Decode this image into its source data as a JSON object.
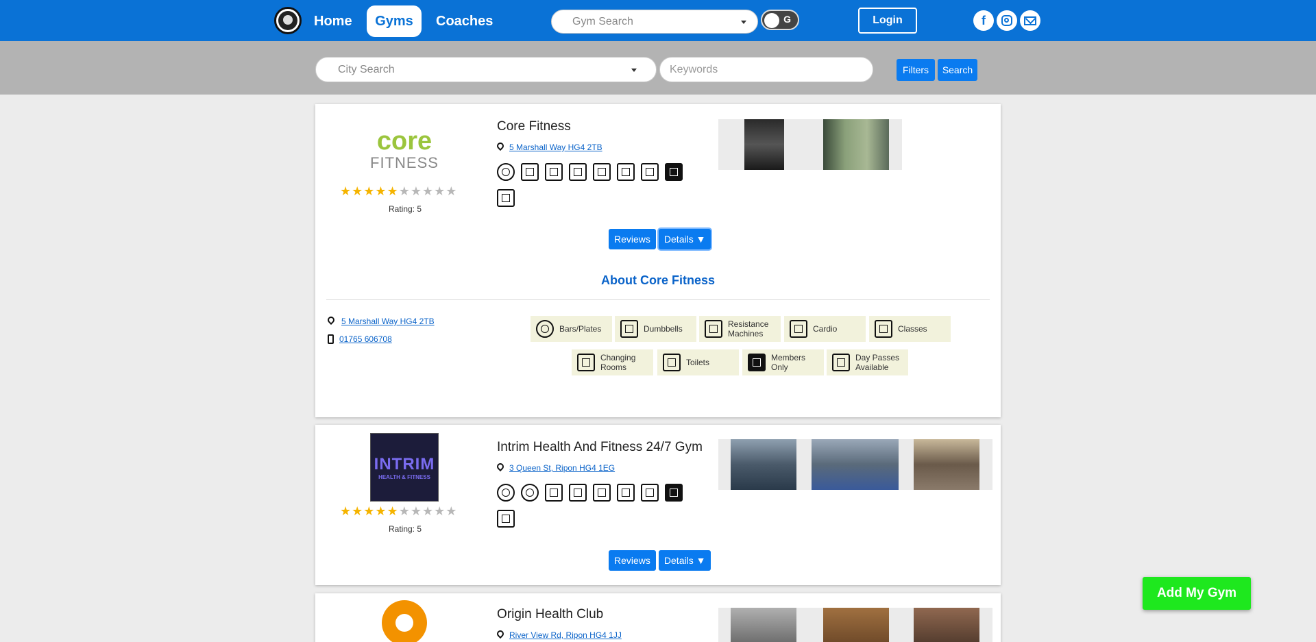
{
  "nav": {
    "home": "Home",
    "gyms": "Gyms",
    "coaches": "Coaches",
    "gym_search_placeholder": "Gym Search",
    "toggle_label": "G",
    "login": "Login",
    "social": [
      "facebook-icon",
      "instagram-icon",
      "email-icon"
    ]
  },
  "search": {
    "city_placeholder": "City Search",
    "keywords_placeholder": "Keywords",
    "filters": "Filters",
    "search": "Search"
  },
  "gyms": [
    {
      "name": "Core Fitness",
      "logo_text_1": "core",
      "logo_text_2": "FITNESS",
      "stars_filled": 5,
      "stars_total": 10,
      "rating": "Rating: 5",
      "address": "5 Marshall Way HG4 2TB",
      "reviews": "Reviews",
      "details": "Details ▼",
      "about_title": "About Core Fitness",
      "phone": "01765 606708",
      "amenities": [
        "Bars/Plates",
        "Dumbbells",
        "Resistance Machines",
        "Cardio",
        "Classes",
        "Changing Rooms",
        "Toilets",
        "Members Only",
        "Day Passes Available"
      ]
    },
    {
      "name": "Intrim Health And Fitness 24/7 Gym",
      "logo_text_1": "INTRIM",
      "logo_text_2": "HEALTH & FITNESS",
      "stars_filled": 5,
      "stars_total": 10,
      "rating": "Rating: 5",
      "address": "3 Queen St, Ripon HG4 1EG",
      "reviews": "Reviews",
      "details": "Details ▼"
    },
    {
      "name": "Origin Health Club",
      "address": "River View Rd, Ripon HG4 1JJ"
    }
  ],
  "add_gym": "Add My Gym",
  "colors": {
    "brand_blue": "#0a72d6",
    "button_blue": "#0a7bf0",
    "add_green": "#1ee81e",
    "star": "#f5b400"
  }
}
